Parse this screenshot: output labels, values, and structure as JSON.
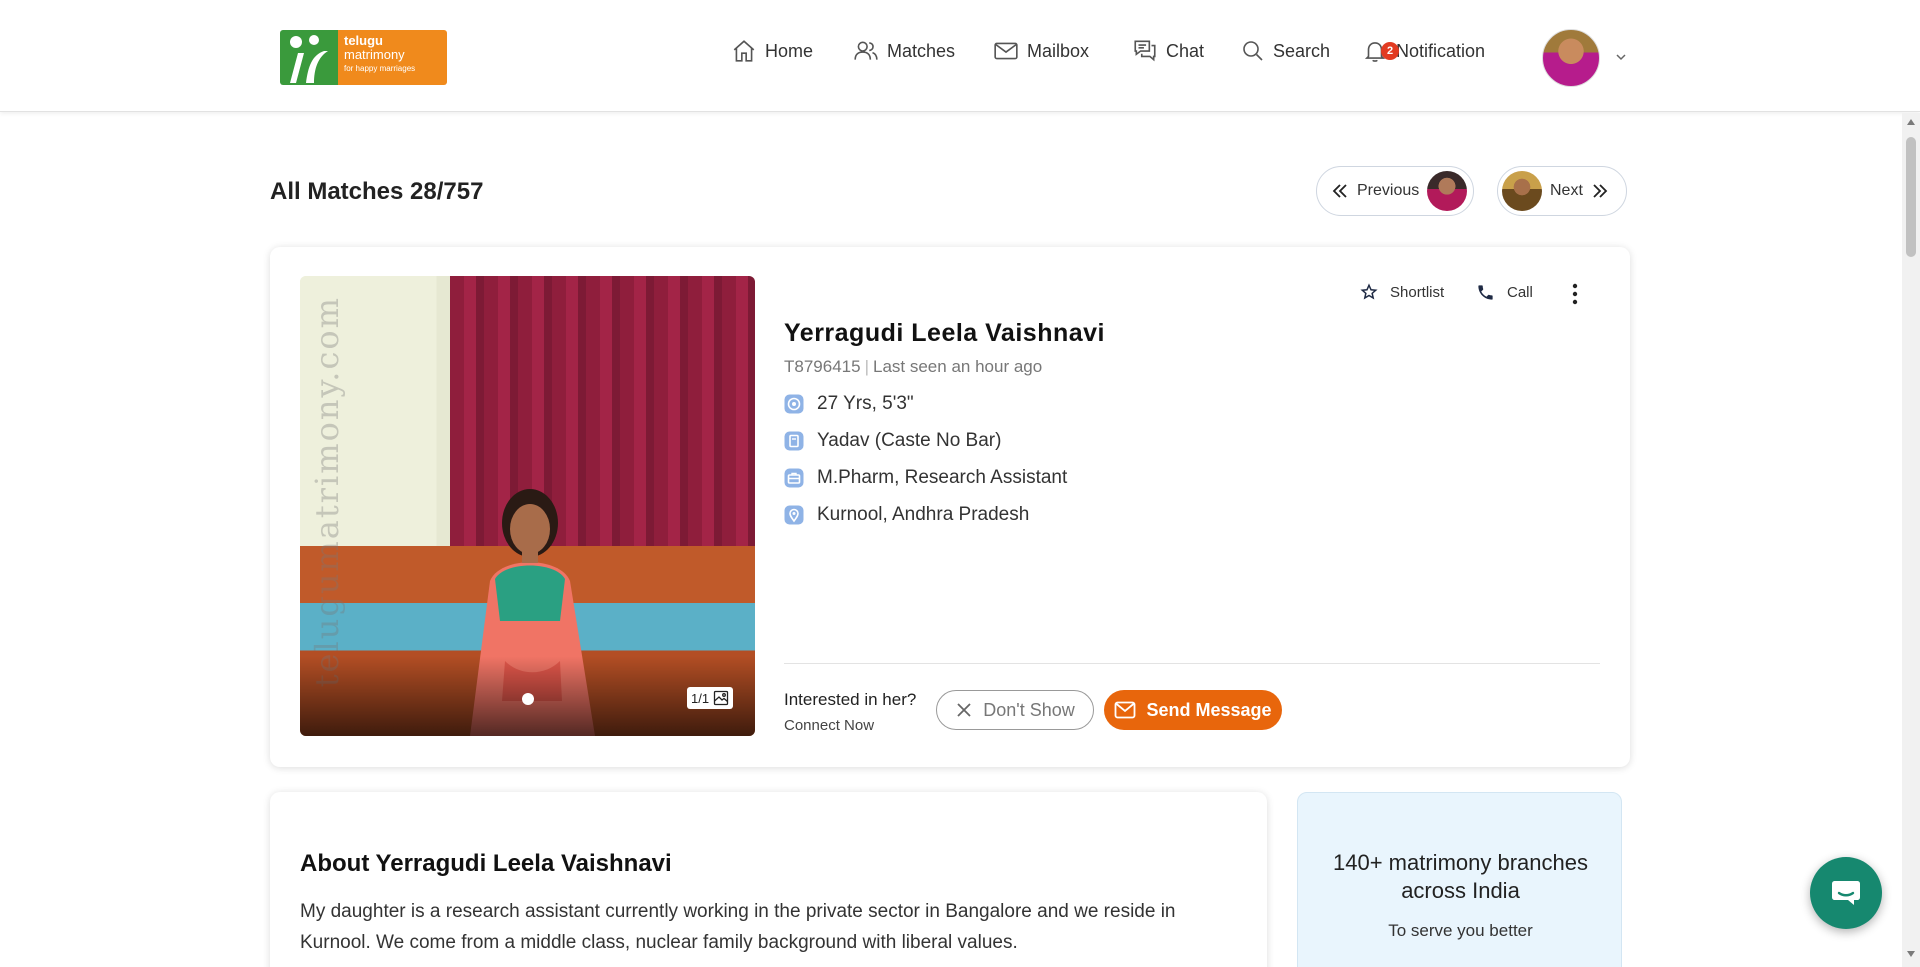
{
  "logo": {
    "line1": "telugu",
    "line2": "matrimony",
    "line3": "for happy marriages"
  },
  "nav": {
    "home": "Home",
    "matches": "Matches",
    "mailbox": "Mailbox",
    "chat": "Chat",
    "search": "Search",
    "notification": "Notification",
    "notification_count": "2"
  },
  "page": {
    "title": "All Matches 28/757"
  },
  "pager": {
    "previous": "Previous",
    "next": "Next"
  },
  "profile": {
    "name": "Yerragudi Leela Vaishnavi",
    "id": "T8796415",
    "last_seen": "Last seen an hour ago",
    "age_height": "27 Yrs, 5'3\"",
    "caste": "Yadav (Caste No Bar)",
    "education_job": "M.Pharm, Research Assistant",
    "location": "Kurnool, Andhra Pradesh",
    "photo_count": "1/1",
    "photo_watermark": "telugumatrimony.com"
  },
  "actions": {
    "shortlist": "Shortlist",
    "call": "Call"
  },
  "interest": {
    "question": "Interested in her?",
    "sub": "Connect Now",
    "dont_show": "Don't Show",
    "send_message": "Send Message"
  },
  "about": {
    "title": "About Yerragudi Leela Vaishnavi",
    "text": "My daughter is a research assistant currently working in the private sector in Bangalore and we reside in Kurnool. We come from a middle class, nuclear family background with liberal values."
  },
  "branches": {
    "title": "140+ matrimony branches across India",
    "sub": "To serve you better"
  },
  "colors": {
    "brand_orange": "#e8660c",
    "logo_green": "#3a9a3c",
    "logo_orange": "#f08a1c",
    "badge_red": "#e23b22",
    "chat_green": "#16886f",
    "icon_blue": "#8fb3e6"
  },
  "icons": {
    "home": "home-icon",
    "matches": "users-icon",
    "mailbox": "envelope-icon",
    "chat": "chat-bubbles-icon",
    "search": "search-icon",
    "notification": "bell-icon",
    "shortlist": "star-icon",
    "call": "phone-icon",
    "more": "kebab-menu-icon",
    "fab": "chat-icon"
  }
}
